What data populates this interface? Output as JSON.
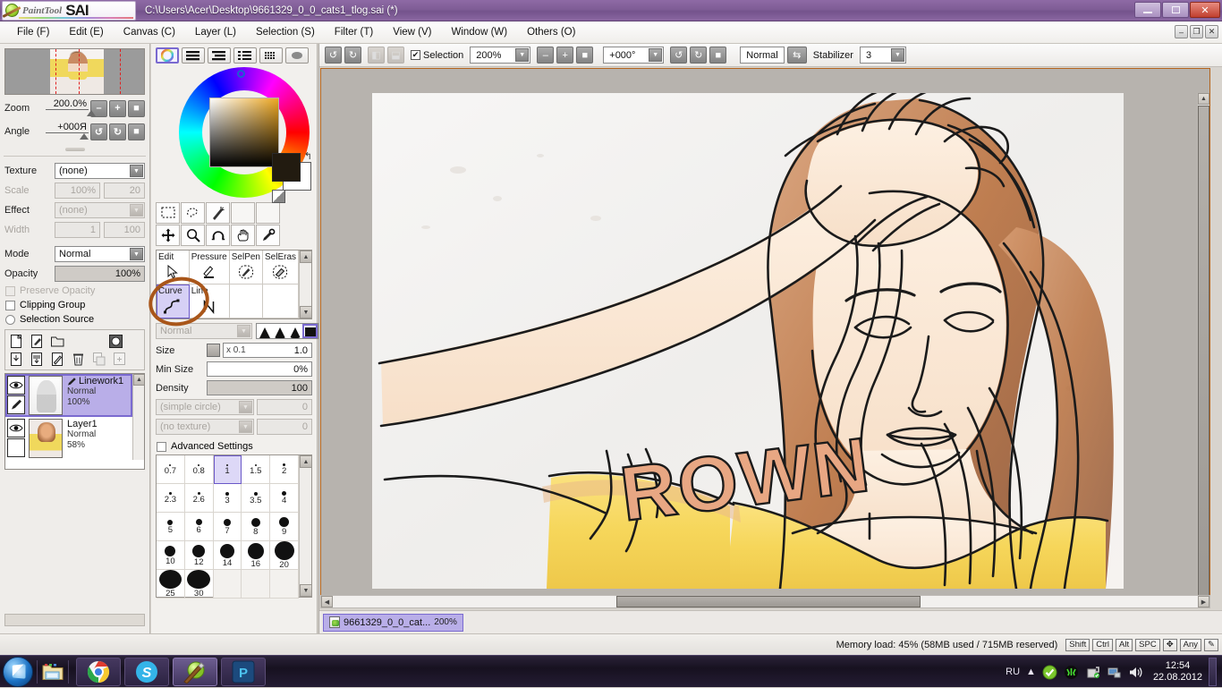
{
  "window": {
    "app_name_italic": "PaintTool",
    "app_name_bold": "SAI",
    "title_path": "C:\\Users\\Acer\\Desktop\\9661329_0_0_cats1_tlog.sai (*)",
    "controls": {
      "minimize": "minimize-icon",
      "restore": "restore-icon",
      "close": "close-icon"
    }
  },
  "menubar": {
    "items": [
      {
        "label": "File (F)",
        "text": "File",
        "key": "F"
      },
      {
        "label": "Edit (E)",
        "text": "Edit",
        "key": "E"
      },
      {
        "label": "Canvas (C)",
        "text": "Canvas",
        "key": "C"
      },
      {
        "label": "Layer (L)",
        "text": "Layer",
        "key": "L"
      },
      {
        "label": "Selection (S)",
        "text": "Selection",
        "key": "S"
      },
      {
        "label": "Filter (T)",
        "text": "Filter",
        "key": "T"
      },
      {
        "label": "View (V)",
        "text": "View",
        "key": "V"
      },
      {
        "label": "Window (W)",
        "text": "Window",
        "key": "W"
      },
      {
        "label": "Others (O)",
        "text": "Others",
        "key": "O"
      }
    ],
    "mdi_buttons": [
      "minimize",
      "restore",
      "close"
    ]
  },
  "navigator": {
    "zoom_label": "Zoom",
    "zoom_value": "200.0%",
    "angle_label": "Angle",
    "angle_value": "+000Я",
    "buttons": [
      "zoom-out",
      "zoom-in",
      "zoom-reset",
      "rotate-left",
      "rotate-right",
      "rotate-reset"
    ]
  },
  "texture_panel": {
    "texture_label": "Texture",
    "texture_value": "(none)",
    "scale_label": "Scale",
    "scale_value": "100%",
    "scale_num": "20",
    "effect_label": "Effect",
    "effect_value": "(none)",
    "width_label": "Width",
    "width_value": "1",
    "width_num": "100"
  },
  "layer_props": {
    "mode_label": "Mode",
    "mode_value": "Normal",
    "opacity_label": "Opacity",
    "opacity_value": "100%",
    "preserve_opacity": "Preserve Opacity",
    "clipping_group": "Clipping Group",
    "selection_source": "Selection Source"
  },
  "layer_toolbar": {
    "buttons": [
      "new-layer-icon",
      "new-linework-layer-icon",
      "new-folder-icon",
      "layer-mask-icon",
      "merge-down-icon",
      "merge-visible-icon",
      "clear-layer-icon",
      "delete-layer-icon",
      "transfer-down-icon",
      "add-below-icon"
    ]
  },
  "layers": [
    {
      "name": "Linework1",
      "mode": "Normal",
      "opacity": "100%",
      "selected": true,
      "type": "linework"
    },
    {
      "name": "Layer1",
      "mode": "Normal",
      "opacity": "58%",
      "selected": false,
      "type": "raster"
    }
  ],
  "color_panel": {
    "mode_buttons": [
      "color-wheel-icon",
      "rgb-sliders-icon",
      "hsv-sliders-icon",
      "color-list-icon",
      "swatch-grid-icon",
      "gradient-icon"
    ],
    "active_mode": "color-wheel-icon",
    "hue_marker_hex": "#1a5fd0",
    "square_color_hex": "#eda721",
    "foreground_hex": "#221b10",
    "background_hex": "#ffffff"
  },
  "tools": {
    "row1": [
      "rect-select-icon",
      "lasso-select-icon",
      "magic-wand-icon",
      "empty",
      "empty"
    ],
    "row2": [
      "move-icon",
      "zoom-icon",
      "rotate-icon",
      "hand-icon",
      "eyedropper-icon"
    ]
  },
  "tool_selector": {
    "cells": [
      {
        "label": "Edit",
        "glyph": "cursor-arrow-icon",
        "active": false
      },
      {
        "label": "Pressure",
        "glyph": "pressure-pen-icon",
        "active": false
      },
      {
        "label": "SelPen",
        "glyph": "selection-pen-icon",
        "active": false
      },
      {
        "label": "SelEras",
        "glyph": "selection-eraser-icon",
        "active": false
      },
      {
        "label": "Curve",
        "glyph": "curve-icon",
        "active": true
      },
      {
        "label": "Line",
        "glyph": "line-icon",
        "active": false
      },
      {
        "label": "",
        "glyph": "empty",
        "active": false
      },
      {
        "label": "",
        "glyph": "empty",
        "active": false
      }
    ],
    "highlight_annotation": "orange-ellipse-highlight"
  },
  "brush": {
    "blend_mode": "Normal",
    "shape_presets": [
      "soft-triangle",
      "medium-triangle",
      "hard-triangle",
      "solid-square"
    ],
    "active_shape": "solid-square",
    "size_label": "Size",
    "size_multiplier": "x 0.1",
    "size_value": "1.0",
    "min_size_label": "Min Size",
    "min_size_value": "0%",
    "density_label": "Density",
    "density_value": "100",
    "shape_dropdown": "(simple circle)",
    "shape_dropdown_num": "0",
    "texture_dropdown": "(no texture)",
    "texture_dropdown_num": "0",
    "advanced_settings": "Advanced Settings"
  },
  "size_grid": {
    "selected": "1",
    "rows": [
      [
        {
          "v": "0.7",
          "d": 2
        },
        {
          "v": "0.8",
          "d": 2
        },
        {
          "v": "1",
          "d": 2
        },
        {
          "v": "1.5",
          "d": 2
        },
        {
          "v": "2",
          "d": 3
        }
      ],
      [
        {
          "v": "2.3",
          "d": 3
        },
        {
          "v": "2.6",
          "d": 3
        },
        {
          "v": "3",
          "d": 4
        },
        {
          "v": "3.5",
          "d": 4
        },
        {
          "v": "4",
          "d": 5
        }
      ],
      [
        {
          "v": "5",
          "d": 6
        },
        {
          "v": "6",
          "d": 7
        },
        {
          "v": "7",
          "d": 8
        },
        {
          "v": "8",
          "d": 10
        },
        {
          "v": "9",
          "d": 11
        }
      ],
      [
        {
          "v": "10",
          "d": 12
        },
        {
          "v": "12",
          "d": 14
        },
        {
          "v": "14",
          "d": 16
        },
        {
          "v": "16",
          "d": 18
        },
        {
          "v": "20",
          "d": 22
        }
      ],
      [
        {
          "v": "25",
          "d": 25
        },
        {
          "v": "30",
          "d": 26
        },
        {
          "v": "",
          "d": 0
        },
        {
          "v": "",
          "d": 0
        },
        {
          "v": "",
          "d": 0
        }
      ]
    ]
  },
  "canvas_toolbar": {
    "undo": "undo-icon",
    "redo": "redo-icon",
    "flip_h": "flip-horizontal-icon",
    "flip_v": "flip-vertical-icon",
    "selection_checkbox_label": "Selection",
    "selection_checked": true,
    "zoom_value": "200%",
    "zoom_out": "zoom-out-icon",
    "zoom_in": "zoom-in-icon",
    "zoom_reset": "zoom-reset-icon",
    "angle_value": "+000°",
    "rotate_ccw": "rotate-ccw-icon",
    "rotate_cw": "rotate-cw-icon",
    "rotate_reset": "rotate-reset-icon",
    "view_mode": "Normal",
    "swap_icon": "swap-arrows-icon",
    "stabilizer_label": "Stabilizer",
    "stabilizer_value": "3"
  },
  "document_tab": {
    "filename": "9661329_0_0_cat...",
    "zoom": "200%"
  },
  "statusbar": {
    "memory": "Memory load: 45% (58MB used / 715MB reserved)",
    "modifiers": [
      "Shift",
      "Ctrl",
      "Alt",
      "SPC"
    ],
    "nav_icon": "pan-icon",
    "any_label": "Any",
    "pen_icon": "pen-icon"
  },
  "taskbar": {
    "start": "windows-start-orb",
    "quick_launch": [
      "explorer-icon"
    ],
    "apps": [
      "chrome-icon",
      "skype-icon",
      "painttool-sai-icon",
      "photoshop-icon"
    ],
    "active_app": "painttool-sai-icon",
    "tray_language": "RU",
    "tray_icons": [
      "show-hidden-icons",
      "antivirus-shield-icon",
      "razer-icon",
      "safely-remove-icon",
      "network-icon",
      "volume-icon"
    ],
    "clock_time": "12:54",
    "clock_date": "22.08.2012"
  }
}
